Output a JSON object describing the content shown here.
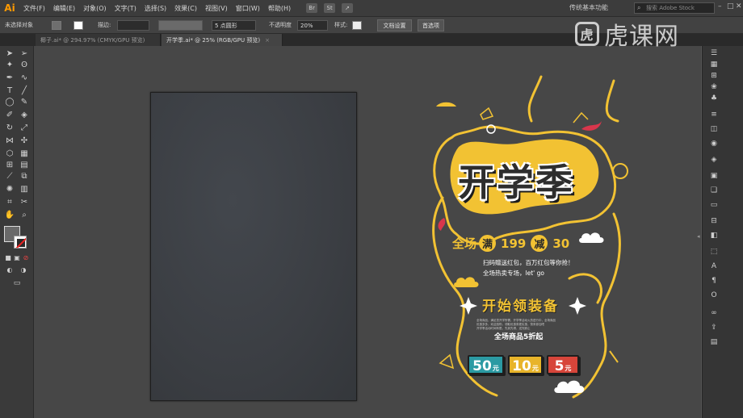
{
  "app": {
    "logo": "Ai",
    "menus": [
      "文件(F)",
      "编辑(E)",
      "对象(O)",
      "文字(T)",
      "选择(S)",
      "效果(C)",
      "视图(V)",
      "窗口(W)",
      "帮助(H)"
    ],
    "mini_icons": [
      "Br",
      "St"
    ],
    "workspace": "传统基本功能",
    "search_placeholder": "搜索 Adobe Stock"
  },
  "control_bar": {
    "no_selection": "未选择对象",
    "stroke_label": "描边:",
    "brush_value": "5 点圆形",
    "opacity_label": "不透明度",
    "opacity_value": "20%",
    "style_label": "样式:",
    "doc_settings": "文档设置",
    "preferences": "首选项"
  },
  "tabs": [
    {
      "label": "椰子.ai* @ 294.97% (CMYK/GPU 预览)",
      "active": false
    },
    {
      "label": "开学季.ai* @ 25% (RGB/GPU 预览)",
      "active": true
    }
  ],
  "poster": {
    "title": "开学季",
    "promo_prefix": "全场",
    "promo_circle1": "满",
    "promo_num1": "199",
    "promo_circle2": "减",
    "promo_num2": "30",
    "sub1": "扫码赠送红包，百万红包等你抢！",
    "sub2": "全场热卖专场，let' go",
    "equip": "开始领装备",
    "tiny1": "全场商品，满足您开学所需，开学季活动火热进行中，全场商品",
    "tiny2": "优惠多多，欢迎选购，领取优惠券更实惠，快来参加吧",
    "tiny3": "开学季活动时间有限，先到先得，送完即止",
    "discount": "全场商品5折起",
    "coupons": [
      {
        "value": "50",
        "unit": "元",
        "color": "#2b9aa3"
      },
      {
        "value": "10",
        "unit": "元",
        "color": "#e8b42a"
      },
      {
        "value": "5",
        "unit": "元",
        "color": "#d7453a"
      }
    ],
    "accent_color": "#f2c233"
  },
  "watermark": {
    "logo_char": "虎",
    "text": "虎课网"
  }
}
